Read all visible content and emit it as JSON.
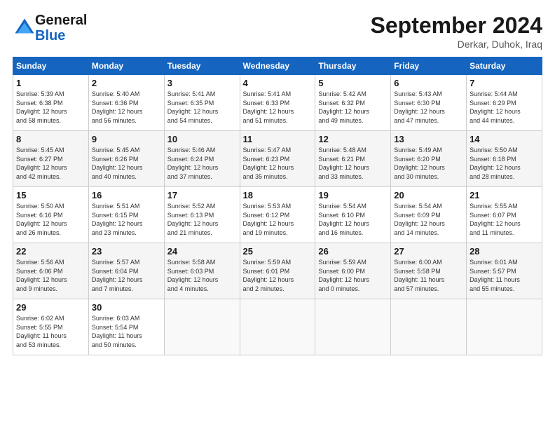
{
  "header": {
    "logo_line1": "General",
    "logo_line2": "Blue",
    "month_title": "September 2024",
    "location": "Derkar, Duhok, Iraq"
  },
  "columns": [
    "Sunday",
    "Monday",
    "Tuesday",
    "Wednesday",
    "Thursday",
    "Friday",
    "Saturday"
  ],
  "weeks": [
    [
      {
        "day": "1",
        "info": "Sunrise: 5:39 AM\nSunset: 6:38 PM\nDaylight: 12 hours\nand 58 minutes."
      },
      {
        "day": "2",
        "info": "Sunrise: 5:40 AM\nSunset: 6:36 PM\nDaylight: 12 hours\nand 56 minutes."
      },
      {
        "day": "3",
        "info": "Sunrise: 5:41 AM\nSunset: 6:35 PM\nDaylight: 12 hours\nand 54 minutes."
      },
      {
        "day": "4",
        "info": "Sunrise: 5:41 AM\nSunset: 6:33 PM\nDaylight: 12 hours\nand 51 minutes."
      },
      {
        "day": "5",
        "info": "Sunrise: 5:42 AM\nSunset: 6:32 PM\nDaylight: 12 hours\nand 49 minutes."
      },
      {
        "day": "6",
        "info": "Sunrise: 5:43 AM\nSunset: 6:30 PM\nDaylight: 12 hours\nand 47 minutes."
      },
      {
        "day": "7",
        "info": "Sunrise: 5:44 AM\nSunset: 6:29 PM\nDaylight: 12 hours\nand 44 minutes."
      }
    ],
    [
      {
        "day": "8",
        "info": "Sunrise: 5:45 AM\nSunset: 6:27 PM\nDaylight: 12 hours\nand 42 minutes."
      },
      {
        "day": "9",
        "info": "Sunrise: 5:45 AM\nSunset: 6:26 PM\nDaylight: 12 hours\nand 40 minutes."
      },
      {
        "day": "10",
        "info": "Sunrise: 5:46 AM\nSunset: 6:24 PM\nDaylight: 12 hours\nand 37 minutes."
      },
      {
        "day": "11",
        "info": "Sunrise: 5:47 AM\nSunset: 6:23 PM\nDaylight: 12 hours\nand 35 minutes."
      },
      {
        "day": "12",
        "info": "Sunrise: 5:48 AM\nSunset: 6:21 PM\nDaylight: 12 hours\nand 33 minutes."
      },
      {
        "day": "13",
        "info": "Sunrise: 5:49 AM\nSunset: 6:20 PM\nDaylight: 12 hours\nand 30 minutes."
      },
      {
        "day": "14",
        "info": "Sunrise: 5:50 AM\nSunset: 6:18 PM\nDaylight: 12 hours\nand 28 minutes."
      }
    ],
    [
      {
        "day": "15",
        "info": "Sunrise: 5:50 AM\nSunset: 6:16 PM\nDaylight: 12 hours\nand 26 minutes."
      },
      {
        "day": "16",
        "info": "Sunrise: 5:51 AM\nSunset: 6:15 PM\nDaylight: 12 hours\nand 23 minutes."
      },
      {
        "day": "17",
        "info": "Sunrise: 5:52 AM\nSunset: 6:13 PM\nDaylight: 12 hours\nand 21 minutes."
      },
      {
        "day": "18",
        "info": "Sunrise: 5:53 AM\nSunset: 6:12 PM\nDaylight: 12 hours\nand 19 minutes."
      },
      {
        "day": "19",
        "info": "Sunrise: 5:54 AM\nSunset: 6:10 PM\nDaylight: 12 hours\nand 16 minutes."
      },
      {
        "day": "20",
        "info": "Sunrise: 5:54 AM\nSunset: 6:09 PM\nDaylight: 12 hours\nand 14 minutes."
      },
      {
        "day": "21",
        "info": "Sunrise: 5:55 AM\nSunset: 6:07 PM\nDaylight: 12 hours\nand 11 minutes."
      }
    ],
    [
      {
        "day": "22",
        "info": "Sunrise: 5:56 AM\nSunset: 6:06 PM\nDaylight: 12 hours\nand 9 minutes."
      },
      {
        "day": "23",
        "info": "Sunrise: 5:57 AM\nSunset: 6:04 PM\nDaylight: 12 hours\nand 7 minutes."
      },
      {
        "day": "24",
        "info": "Sunrise: 5:58 AM\nSunset: 6:03 PM\nDaylight: 12 hours\nand 4 minutes."
      },
      {
        "day": "25",
        "info": "Sunrise: 5:59 AM\nSunset: 6:01 PM\nDaylight: 12 hours\nand 2 minutes."
      },
      {
        "day": "26",
        "info": "Sunrise: 5:59 AM\nSunset: 6:00 PM\nDaylight: 12 hours\nand 0 minutes."
      },
      {
        "day": "27",
        "info": "Sunrise: 6:00 AM\nSunset: 5:58 PM\nDaylight: 11 hours\nand 57 minutes."
      },
      {
        "day": "28",
        "info": "Sunrise: 6:01 AM\nSunset: 5:57 PM\nDaylight: 11 hours\nand 55 minutes."
      }
    ],
    [
      {
        "day": "29",
        "info": "Sunrise: 6:02 AM\nSunset: 5:55 PM\nDaylight: 11 hours\nand 53 minutes."
      },
      {
        "day": "30",
        "info": "Sunrise: 6:03 AM\nSunset: 5:54 PM\nDaylight: 11 hours\nand 50 minutes."
      },
      {
        "day": "",
        "info": ""
      },
      {
        "day": "",
        "info": ""
      },
      {
        "day": "",
        "info": ""
      },
      {
        "day": "",
        "info": ""
      },
      {
        "day": "",
        "info": ""
      }
    ]
  ]
}
